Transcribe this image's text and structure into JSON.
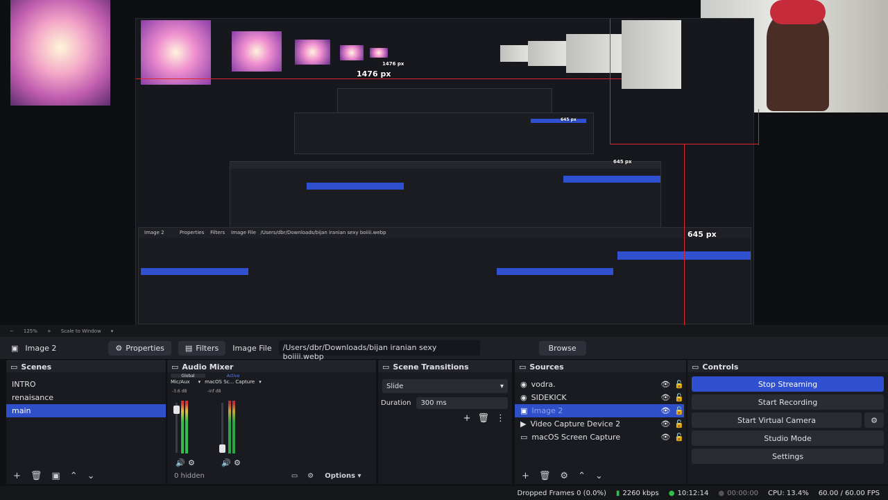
{
  "preview": {
    "labels": [
      "1476 px",
      "1476 px",
      "645 px",
      "645 px",
      "645 px"
    ],
    "zoom": "125%",
    "scale": "Scale to Window"
  },
  "source_bar": {
    "source_name": "Image 2",
    "properties_label": "Properties",
    "filters_label": "Filters",
    "image_file_label": "Image File",
    "path": "/Users/dbr/Downloads/bijan iranian sexy boiiii.webp",
    "browse_label": "Browse"
  },
  "scenes": {
    "title": "Scenes",
    "items": [
      "INTRO",
      "renaisance",
      "main"
    ],
    "selected": "main"
  },
  "audio_mixer": {
    "title": "Audio Mixer",
    "tabs": [
      "Global",
      "Active"
    ],
    "channels": [
      {
        "name": "Mic/Aux",
        "db": "-3.6 dB"
      },
      {
        "name": "macOS Sc... Capture",
        "db": "-inf dB"
      }
    ],
    "hidden": "0 hidden",
    "options_label": "Options"
  },
  "transitions": {
    "title": "Scene Transitions",
    "type": "Slide",
    "duration_label": "Duration",
    "duration_value": "300 ms"
  },
  "sources": {
    "title": "Sources",
    "items": [
      "vodra.",
      "SIDEKICK",
      "Image 2",
      "Video Capture Device 2",
      "macOS Screen Capture"
    ],
    "selected": "Image 2"
  },
  "controls": {
    "title": "Controls",
    "buttons": [
      "Stop Streaming",
      "Start Recording",
      "Start Virtual Camera",
      "Studio Mode",
      "Settings"
    ]
  },
  "status": {
    "dropped": "Dropped Frames 0 (0.0%)",
    "bitrate": "2260 kbps",
    "stream_time": "10:12:14",
    "rec_time": "00:00:00",
    "cpu": "CPU: 13.4%",
    "fps": "60.00 / 60.00 FPS"
  },
  "colors": {
    "accent": "#2f50d0",
    "guide": "#e0262d"
  }
}
